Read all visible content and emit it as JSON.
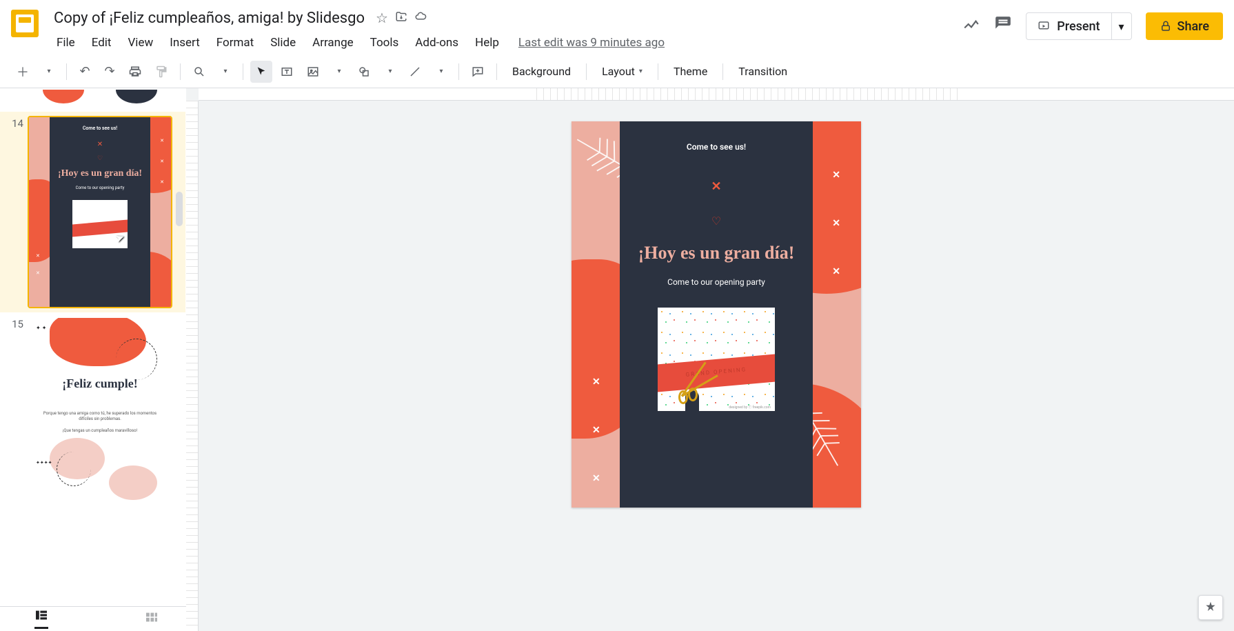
{
  "header": {
    "doc_title": "Copy of ¡Feliz cumpleaños, amiga! by Slidesgo",
    "star_icon": "☆",
    "move_icon": "▢",
    "cloud_icon": "☁",
    "last_edit": "Last edit was 9 minutes ago",
    "menus": {
      "file": "File",
      "edit": "Edit",
      "view": "View",
      "insert": "Insert",
      "format": "Format",
      "slide": "Slide",
      "arrange": "Arrange",
      "tools": "Tools",
      "addons": "Add-ons",
      "help": "Help"
    },
    "present": "Present",
    "share": "Share"
  },
  "toolbar": {
    "background": "Background",
    "layout": "Layout",
    "theme": "Theme",
    "transition": "Transition"
  },
  "filmstrip": {
    "slides": {
      "s14": {
        "num": "14"
      },
      "s15": {
        "num": "15"
      }
    }
  },
  "slide_content": {
    "top_text": "Come to see us!",
    "x_icon": "✕",
    "heart_icon": "♡",
    "title": "¡Hoy es un gran día!",
    "subtitle": "Come to our opening party",
    "ribbon_text": "GRAND OPENING",
    "credit": "designed by ⓕ freepik.com"
  },
  "slide15": {
    "title": "¡Feliz cumple!",
    "body1": "Porque tengo una amiga como tú, he superado los momentos difíciles sin problemas.",
    "body2": "¡Que tengas un cumpleaños maravilloso!"
  },
  "decorative_x": "✕",
  "leaf_glyph": "❋"
}
